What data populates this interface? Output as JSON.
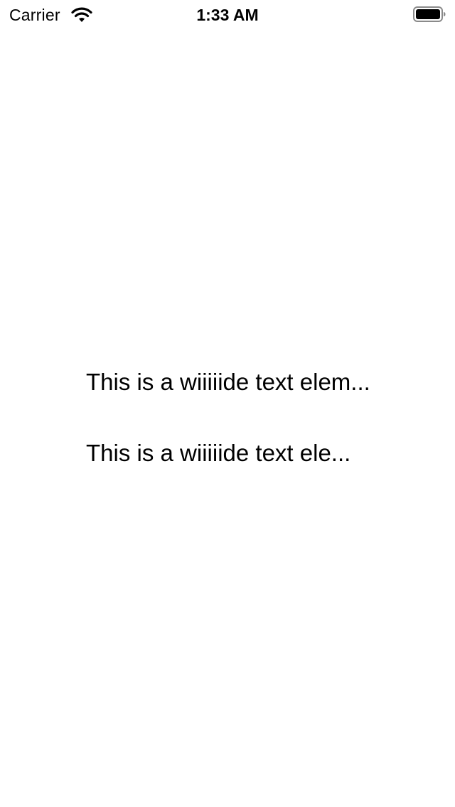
{
  "status_bar": {
    "carrier": "Carrier",
    "time": "1:33 AM",
    "icons": {
      "wifi": "wifi-icon",
      "battery": "battery-icon"
    }
  },
  "content": {
    "lines": [
      "This is a wiiiiide text elem...",
      "This is a wiiiiide text ele..."
    ]
  }
}
